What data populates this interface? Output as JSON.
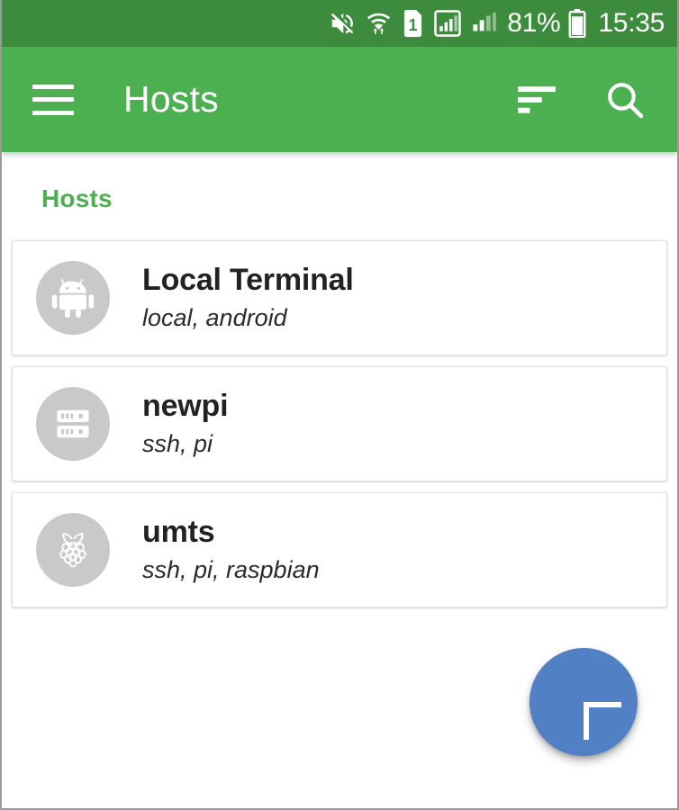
{
  "status_bar": {
    "background": "#3d8b3d",
    "icons": [
      {
        "name": "volume-mute-icon",
        "label": "muted"
      },
      {
        "name": "wifi-transfer-icon",
        "label": "wifi"
      },
      {
        "name": "sim-card-1-icon",
        "label": "1"
      },
      {
        "name": "signal-bars-boxed-icon",
        "label": "signal 1"
      },
      {
        "name": "signal-bars-icon",
        "label": "signal 2"
      }
    ],
    "battery_percent": "81%",
    "clock": "15:35"
  },
  "app_bar": {
    "background": "#4caf50",
    "title": "Hosts",
    "menu_icon": "hamburger-menu-icon",
    "sort_icon": "sort-icon",
    "search_icon": "search-icon"
  },
  "content": {
    "section_header": "Hosts",
    "section_header_color": "#4caf50",
    "hosts": [
      {
        "title": "Local Terminal",
        "subtitle": "local, android",
        "icon": "android-robot-icon"
      },
      {
        "title": "newpi",
        "subtitle": "ssh, pi",
        "icon": "server-rack-icon"
      },
      {
        "title": "umts",
        "subtitle": "ssh, pi, raspbian",
        "icon": "raspberry-pi-icon"
      }
    ]
  },
  "fab": {
    "label": "+",
    "color": "#5180c4",
    "icon": "plus-icon"
  }
}
